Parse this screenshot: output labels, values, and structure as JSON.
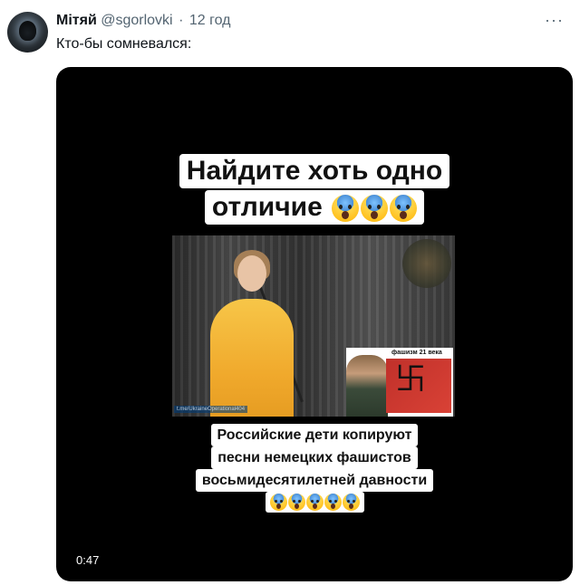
{
  "tweet": {
    "author_name": "Мітяй",
    "author_handle": "@sgorlovki",
    "separator": "·",
    "time": "12 год",
    "text": "Кто-бы сомневался:",
    "more_icon": "more-horizontal-icon"
  },
  "video": {
    "caption_top_line1": "Найдите хоть одно",
    "caption_top_line2": "отличие",
    "caption_bottom_line1": "Российские дети копируют",
    "caption_bottom_line2": "песни немецких фашистов",
    "caption_bottom_line3": "восьмидесятилетней давности",
    "inset_title": "фашизм 21 века",
    "watermark": "t.me/UkraineOperational404",
    "duration": "0:47",
    "emoji_icon": "screaming-face-emoji"
  },
  "colors": {
    "text_primary": "#0f1419",
    "text_secondary": "#536471",
    "video_background": "#000000"
  }
}
